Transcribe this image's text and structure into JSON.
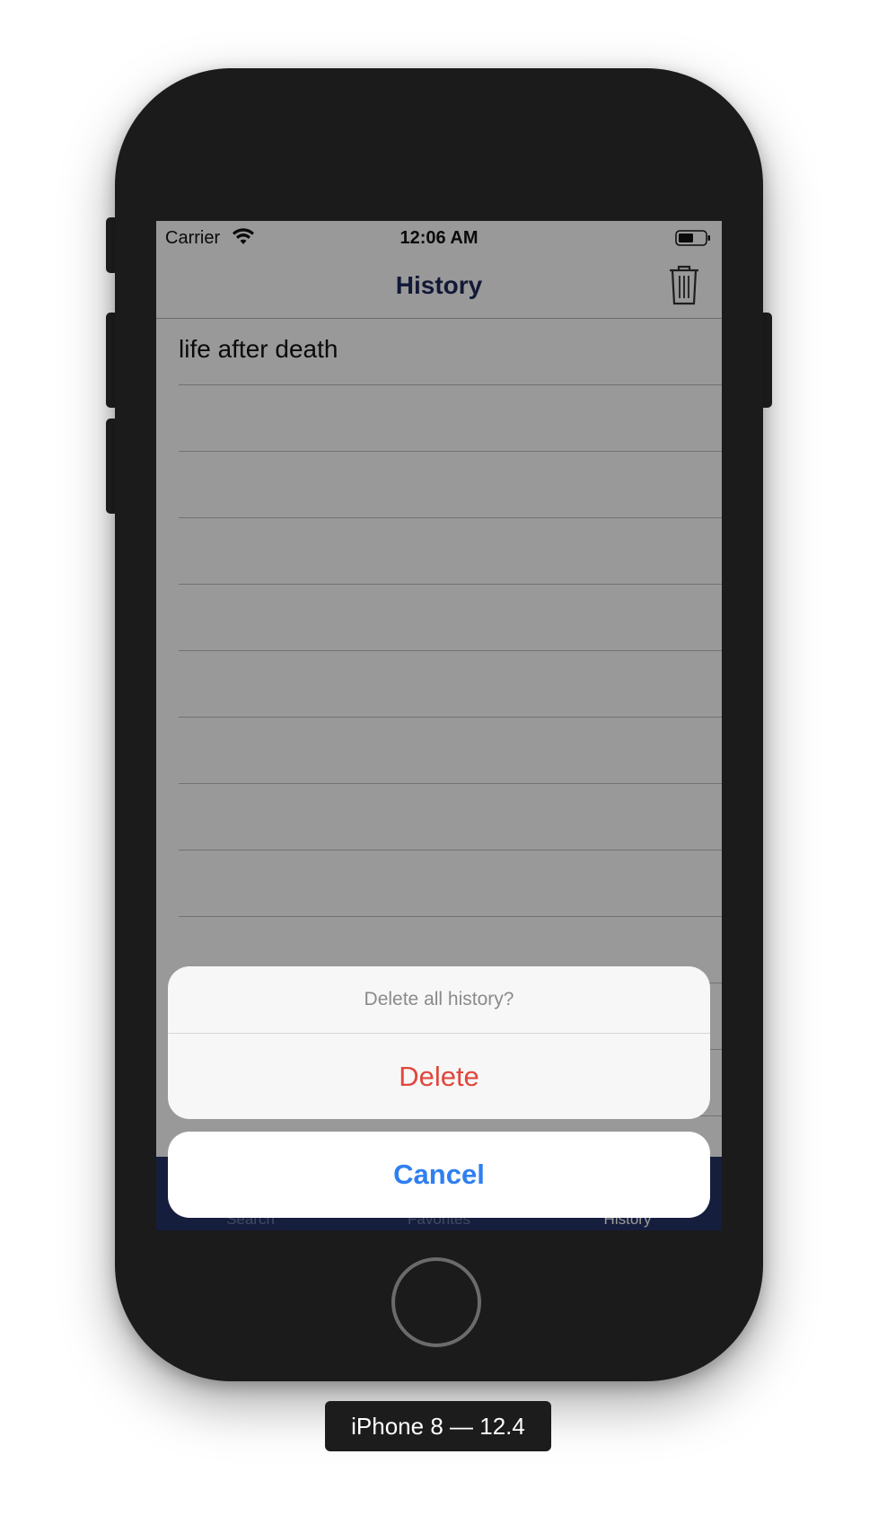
{
  "status_bar": {
    "carrier": "Carrier",
    "time": "12:06 AM",
    "wifi_icon": "wifi-icon",
    "battery_icon": "battery-icon"
  },
  "nav": {
    "title": "History",
    "trash_icon": "trash-icon"
  },
  "history": {
    "items": [
      "life after death",
      "",
      "",
      "",
      "",
      "",
      "",
      "",
      "",
      "",
      "",
      ""
    ]
  },
  "tab_bar": {
    "tabs": [
      {
        "label": "Search"
      },
      {
        "label": "Favorites"
      },
      {
        "label": "History"
      }
    ],
    "active": "History"
  },
  "action_sheet": {
    "message": "Delete all history?",
    "delete_label": "Delete",
    "cancel_label": "Cancel"
  },
  "device_label": "iPhone 8 — 12.4",
  "colors": {
    "nav_title": "#1f2b5c",
    "tab_bar_bg": "#263366",
    "delete": "#e0473c",
    "cancel": "#2f7ff0"
  }
}
